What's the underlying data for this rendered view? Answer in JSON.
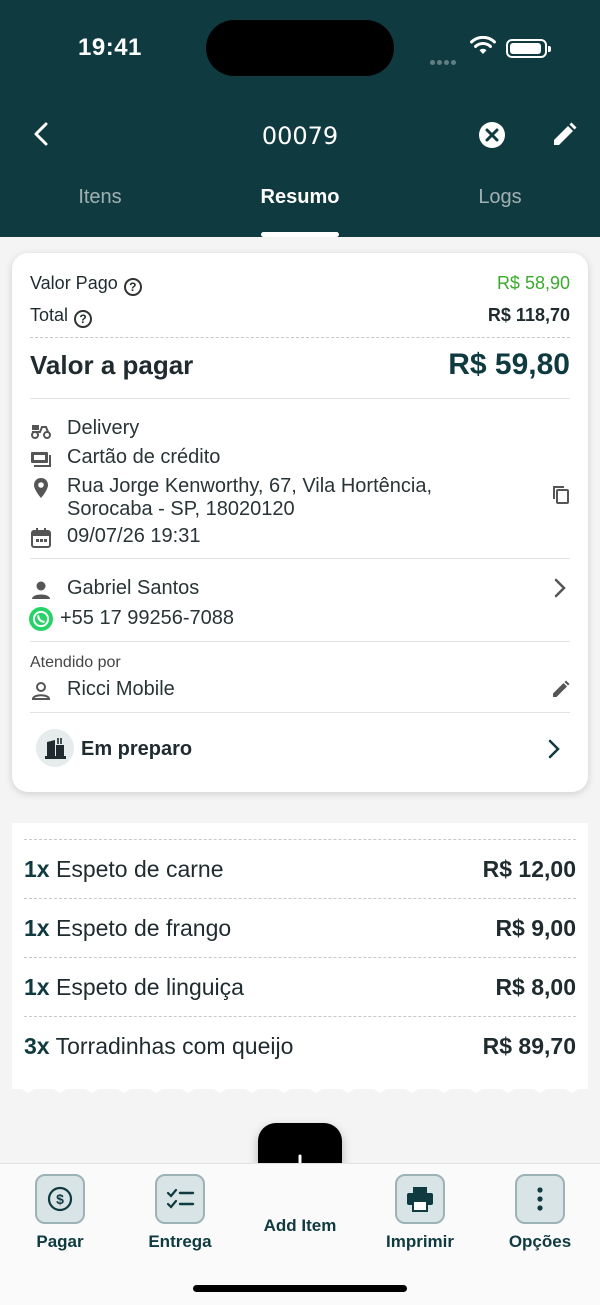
{
  "status_bar": {
    "time": "19:41"
  },
  "header": {
    "order_number": "00079"
  },
  "tabs": [
    {
      "label": "Itens"
    },
    {
      "label": "Resumo",
      "active": true
    },
    {
      "label": "Logs"
    }
  ],
  "summary": {
    "paid_label": "Valor Pago",
    "paid_value": "R$ 58,90",
    "total_label": "Total",
    "total_value": "R$ 118,70",
    "due_label": "Valor a pagar",
    "due_value": "R$ 59,80"
  },
  "order_info": {
    "delivery_type": "Delivery",
    "payment_method": "Cartão de crédito",
    "address_line1": "Rua Jorge Kenworthy, 67, Vila Hortência,",
    "address_line2": "Sorocaba - SP, 18020120",
    "datetime": "09/07/26 19:31"
  },
  "customer": {
    "name": "Gabriel Santos",
    "phone": "+55 17 99256-7088"
  },
  "attendant": {
    "label": "Atendido por",
    "name": "Ricci Mobile"
  },
  "order_status": {
    "label": "Em preparo"
  },
  "items": [
    {
      "qty": "1x",
      "name": "Espeto de carne",
      "price": "R$ 12,00"
    },
    {
      "qty": "1x",
      "name": "Espeto de frango",
      "price": "R$ 9,00"
    },
    {
      "qty": "1x",
      "name": "Espeto de linguiça",
      "price": "R$ 8,00"
    },
    {
      "qty": "3x",
      "name": "Torradinhas com queijo",
      "price": "R$ 89,70"
    }
  ],
  "bottom_bar": {
    "pay": "Pagar",
    "delivery": "Entrega",
    "add_item": "Add Item",
    "print": "Imprimir",
    "options": "Opções"
  },
  "colors": {
    "header_bg": "#0f3a40",
    "paid_green": "#3aab2c",
    "whatsapp_green": "#25d366"
  }
}
